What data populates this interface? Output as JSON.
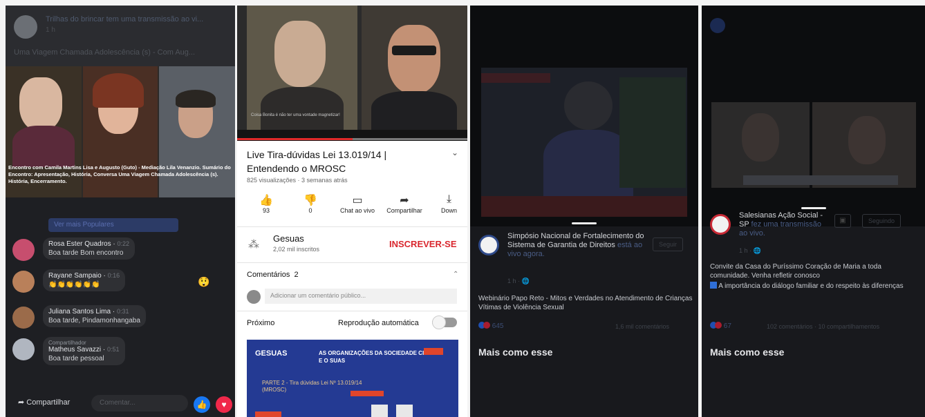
{
  "panel1": {
    "header_title": "Trilhas do brincar tem uma transmissão ao vi...",
    "header_time": "1 h",
    "header_subtitle": "Uma Viagem Chamada Adolescência (s) - Com Aug...",
    "video_caption": "Encontro com Camila Martins Lisa e Augusto (Guto) - Mediação Lila Venanzio. Sumário do Encontro: Apresentação, História, Conversa Uma Viagem Chamada Adolescência (s). História, Encerramento.",
    "live_button_label": "Ver mais Populares",
    "comments": [
      {
        "name": "Rosa Ester Quadros",
        "time": "0:22",
        "text": "Boa tarde Bom encontro",
        "avatar": "#c74e6e"
      },
      {
        "name": "Rayane Sampaio",
        "time": "0:16",
        "text": "👏👏👏👏👏👏",
        "avatar": "#b9805a"
      },
      {
        "name": "Juliana Santos Lima",
        "time": "0:31",
        "text": "Boa tarde, Pindamonhangaba",
        "avatar": "#9b6b4a"
      },
      {
        "name": "Matheus Savazzi",
        "time": "0:51",
        "text": "Boa tarde pessoal",
        "avatar": "#b0b6c0",
        "tag": "Compartilhador"
      }
    ],
    "share_label": "Compartilhar",
    "comment_placeholder": "Comentar..."
  },
  "panel2": {
    "cam_caption": "Coisa Bonita é não ter uma vontade magnetizar!",
    "video_title": "Live Tira-dúvidas Lei 13.019/14 | Entendendo o MROSC",
    "meta": "825 visualizações · 3 semanas atrás",
    "actions": [
      {
        "icon": "👍",
        "label": "93"
      },
      {
        "icon": "👎",
        "label": "0"
      },
      {
        "icon": "▭",
        "label": "Chat ao vivo"
      },
      {
        "icon": "➦",
        "label": "Compartilhar"
      },
      {
        "icon": "⤓",
        "label": "Down"
      }
    ],
    "progress": 0.5,
    "channel": "Gesuas",
    "subscribers": "2,02 mil inscritos",
    "subscribe": "INSCREVER-SE",
    "comments_label": "Comentários",
    "comments_count": "2",
    "add_comment": "Adicionar um comentário público...",
    "next_label": "Próximo",
    "autoplay_label": "Reprodução automática",
    "thumb_brand": "GESUAS",
    "thumb_headline": "AS ORGANIZAÇÕES DA SOCIEDADE CIVIL E O SUAS",
    "thumb_part": "PARTE 2 - Tira dúvidas Lei Nº 13.019/14 (MROSC)"
  },
  "panel3": {
    "page_name": "Simpósio Nacional de Fortalecimento do Sistema de Garantia de Direitos",
    "status": "está ao vivo agora.",
    "time": "1 h · 🌐",
    "follow": "Seguir",
    "description": "Webinário Papo Reto - Mitos e Verdades no Atendimento de Crianças Vítimas de Violência Sexual",
    "reactions": "645",
    "comments": "1,6 mil comentários",
    "more_like": "Mais como esse"
  },
  "panel4": {
    "page_name": "Salesianas Ação Social - SP",
    "status": "fez uma transmissão ao vivo.",
    "time": "1 h · 🌐",
    "follow": "Seguindo",
    "description": "Convite da Casa do Puríssimo Coração de Maria a toda comunidade. Venha refletir conosco",
    "bullet": "A importância do diálogo familiar e do respeito às diferenças",
    "reactions": "67",
    "stats": "102 comentários · 10 compartilhamentos",
    "more_like": "Mais como esse"
  }
}
